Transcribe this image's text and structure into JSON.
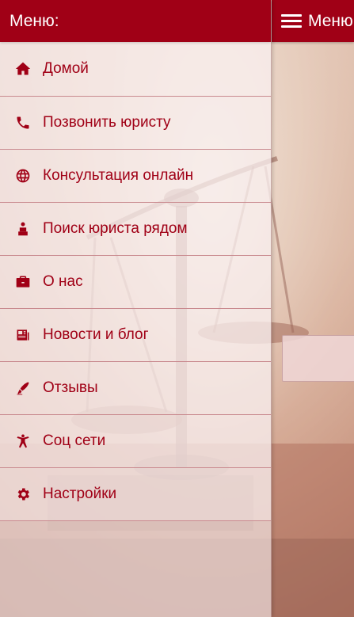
{
  "menu": {
    "title": "Меню:",
    "items": [
      {
        "label": "Домой",
        "icon": "home-icon"
      },
      {
        "label": "Позвонить юристу",
        "icon": "phone-icon"
      },
      {
        "label": "Консультация онлайн",
        "icon": "globe-icon"
      },
      {
        "label": "Поиск юриста рядом",
        "icon": "person-pin-icon"
      },
      {
        "label": "О нас",
        "icon": "briefcase-icon"
      },
      {
        "label": "Новости и блог",
        "icon": "newspaper-icon"
      },
      {
        "label": "Отзывы",
        "icon": "pen-icon"
      },
      {
        "label": "Соц сети",
        "icon": "accessibility-icon"
      },
      {
        "label": "Настройки",
        "icon": "gear-icon"
      }
    ]
  },
  "header": {
    "title": "Меню"
  },
  "colors": {
    "brand": "#a00016",
    "menu_text": "#a00016",
    "header_text": "#ffffff",
    "divider": "#c98a8f"
  }
}
